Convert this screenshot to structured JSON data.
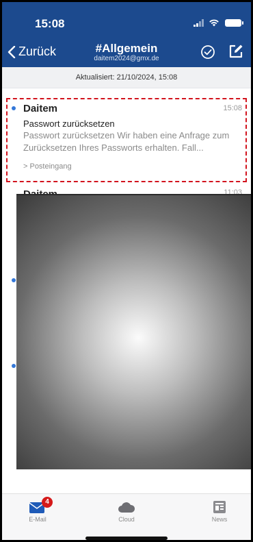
{
  "status_bar": {
    "time": "15:08"
  },
  "header": {
    "back_label": "Zurück",
    "title": "#Allgemein",
    "subtitle": "daitem2024@gmx.de",
    "accent_color": "#1c4a8e"
  },
  "updated_label": "Aktualisiert: 21/10/2024, 15:08",
  "mails": [
    {
      "sender": "Daitem",
      "time": "15:08",
      "subject": "Passwort zurücksetzen",
      "preview": "Passwort zurücksetzen Wir haben eine Anfrage zum Zurücksetzen Ihres Passworts erhalten. Fall...",
      "folder": "> Posteingang",
      "unread": true
    },
    {
      "sender": "Daitem",
      "time": "11:03"
    }
  ],
  "tabs": [
    {
      "label": "E-Mail",
      "icon": "mail-icon",
      "badge": "4"
    },
    {
      "label": "Cloud",
      "icon": "cloud-icon"
    },
    {
      "label": "News",
      "icon": "news-icon"
    }
  ]
}
